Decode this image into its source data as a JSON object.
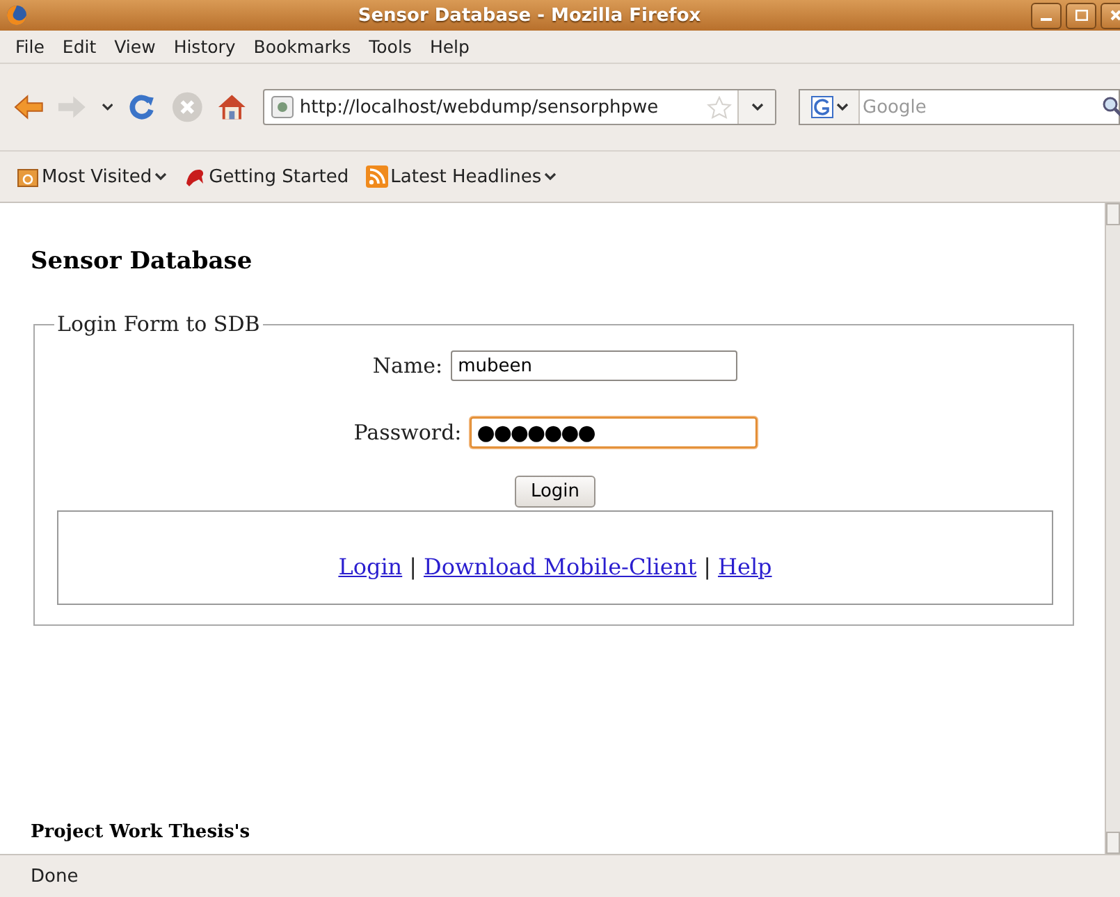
{
  "window": {
    "title": "Sensor Database - Mozilla Firefox"
  },
  "menu": [
    {
      "label": "File"
    },
    {
      "label": "Edit"
    },
    {
      "label": "View"
    },
    {
      "label": "History"
    },
    {
      "label": "Bookmarks"
    },
    {
      "label": "Tools"
    },
    {
      "label": "Help"
    }
  ],
  "toolbar": {
    "address": "http://localhost/webdump/sensorphpwe",
    "search_placeholder": "Google",
    "forward_disabled": true,
    "stop_disabled": true
  },
  "bookmarks": [
    {
      "label": "Most Visited",
      "kind": "folder"
    },
    {
      "label": "Getting Started",
      "kind": "link"
    },
    {
      "label": "Latest Headlines",
      "kind": "feed"
    }
  ],
  "page": {
    "heading": "Sensor Database",
    "legend": "Login Form to SDB",
    "fields": [
      {
        "label": "Name:",
        "value": "mubeen",
        "focused": false
      },
      {
        "label": "Password:",
        "value": "●●●●●●●",
        "focused": true
      }
    ],
    "button": "Login",
    "links": [
      "Login",
      "Download Mobile-Client",
      "Help"
    ],
    "separator": "|",
    "footer": "Project Work Thesis's"
  },
  "status_bar": "Done"
}
